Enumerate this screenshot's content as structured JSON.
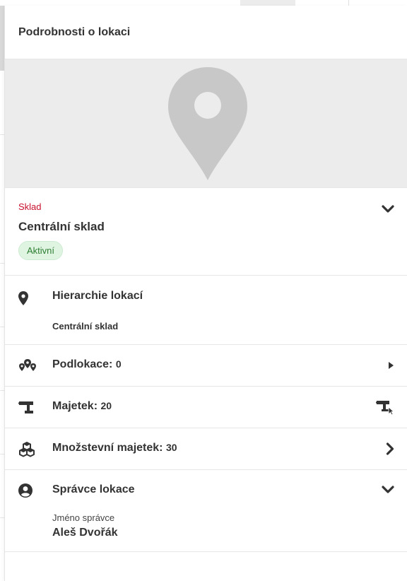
{
  "panel": {
    "title": "Podrobnosti o lokaci"
  },
  "map": {
    "icon": "map-marker-icon",
    "background_color": "#ececec",
    "icon_color": "#c8c8c8"
  },
  "location": {
    "type": "Sklad",
    "type_color": "#c8102e",
    "name": "Centrální sklad",
    "status": "Aktivní",
    "status_color": "#2e7d32",
    "status_bg": "#dff5e2"
  },
  "hierarchy": {
    "label": "Hierarchie lokací",
    "path": "Centrální sklad"
  },
  "sublocations": {
    "label": "Podlokace:",
    "count": "0"
  },
  "assets": {
    "label": "Majetek:",
    "count": "20"
  },
  "quantity_assets": {
    "label": "Množstevní majetek:",
    "count": "30"
  },
  "administrator": {
    "label": "Správce lokace",
    "name_label": "Jméno správce",
    "name": "Aleš Dvořák"
  }
}
